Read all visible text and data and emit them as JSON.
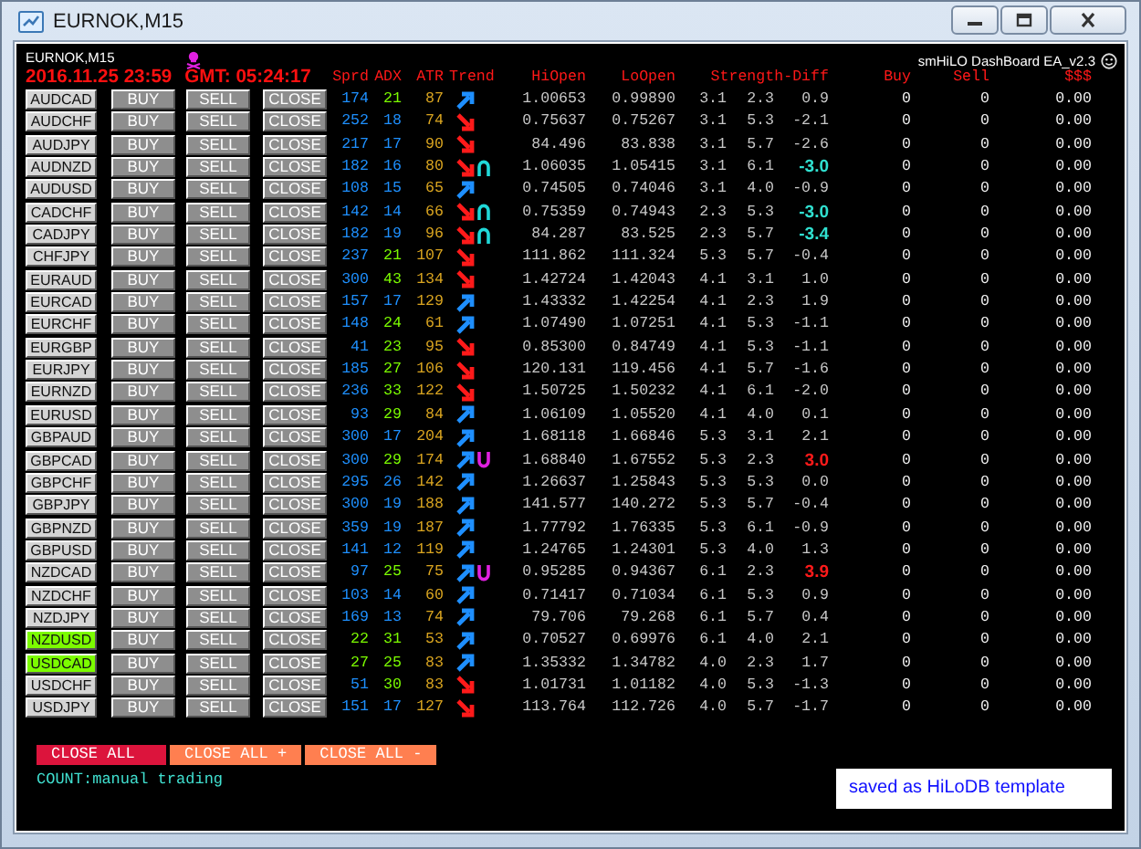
{
  "window": {
    "title": "EURNOK,M15"
  },
  "symbol_label": "EURNOK,M15",
  "ea_name": "smHiLO DashBoard EA_v2.3",
  "date": "2016.11.25 23:59",
  "gmt": "GMT: 05:24:17",
  "columns": [
    "Sprd",
    "ADX",
    "ATR",
    "Trend",
    "HiOpen",
    "LoOpen",
    "Strength-Diff",
    "Buy",
    "Sell",
    "$$$"
  ],
  "rows": [
    {
      "pair": "AUDCAD",
      "selected": false,
      "buy": "BUY",
      "sell": "SELL",
      "close": "CLOSE",
      "spread": "174",
      "spread_low": false,
      "adx": "21",
      "adx_strong": true,
      "atr": "87",
      "rising": true,
      "sell_signal": false,
      "buy_signal": false,
      "hi": "1.00653",
      "lo": "0.99890",
      "s1": "3.1",
      "s2": "2.3",
      "diff": "0.9",
      "diff_sell_alert": false,
      "diff_buy_alert": false,
      "buys": "0",
      "sells": "0",
      "profit": "0.00"
    },
    {
      "pair": "AUDCHF",
      "selected": false,
      "buy": "BUY",
      "sell": "SELL",
      "close": "CLOSE",
      "spread": "252",
      "spread_low": false,
      "adx": "18",
      "adx_strong": false,
      "atr": "74",
      "rising": false,
      "sell_signal": false,
      "buy_signal": false,
      "hi": "0.75637",
      "lo": "0.75267",
      "s1": "3.1",
      "s2": "5.3",
      "diff": "-2.1",
      "diff_sell_alert": false,
      "diff_buy_alert": false,
      "buys": "0",
      "sells": "0",
      "profit": "0.00"
    },
    {
      "pair": "AUDJPY",
      "selected": false,
      "buy": "BUY",
      "sell": "SELL",
      "close": "CLOSE",
      "spread": "217",
      "spread_low": false,
      "adx": "17",
      "adx_strong": false,
      "atr": "90",
      "rising": false,
      "sell_signal": false,
      "buy_signal": false,
      "hi": "84.496",
      "lo": "83.838",
      "s1": "3.1",
      "s2": "5.7",
      "diff": "-2.6",
      "diff_sell_alert": false,
      "diff_buy_alert": false,
      "buys": "0",
      "sells": "0",
      "profit": "0.00"
    },
    {
      "pair": "AUDNZD",
      "selected": false,
      "buy": "BUY",
      "sell": "SELL",
      "close": "CLOSE",
      "spread": "182",
      "spread_low": false,
      "adx": "16",
      "adx_strong": false,
      "atr": "80",
      "rising": false,
      "sell_signal": true,
      "buy_signal": false,
      "hi": "1.06035",
      "lo": "1.05415",
      "s1": "3.1",
      "s2": "6.1",
      "diff": "-3.0",
      "diff_sell_alert": true,
      "diff_buy_alert": false,
      "buys": "0",
      "sells": "0",
      "profit": "0.00"
    },
    {
      "pair": "AUDUSD",
      "selected": false,
      "buy": "BUY",
      "sell": "SELL",
      "close": "CLOSE",
      "spread": "108",
      "spread_low": false,
      "adx": "15",
      "adx_strong": false,
      "atr": "65",
      "rising": true,
      "sell_signal": false,
      "buy_signal": false,
      "hi": "0.74505",
      "lo": "0.74046",
      "s1": "3.1",
      "s2": "4.0",
      "diff": "-0.9",
      "diff_sell_alert": false,
      "diff_buy_alert": false,
      "buys": "0",
      "sells": "0",
      "profit": "0.00"
    },
    {
      "pair": "CADCHF",
      "selected": false,
      "buy": "BUY",
      "sell": "SELL",
      "close": "CLOSE",
      "spread": "142",
      "spread_low": false,
      "adx": "14",
      "adx_strong": false,
      "atr": "66",
      "rising": false,
      "sell_signal": true,
      "buy_signal": false,
      "hi": "0.75359",
      "lo": "0.74943",
      "s1": "2.3",
      "s2": "5.3",
      "diff": "-3.0",
      "diff_sell_alert": true,
      "diff_buy_alert": false,
      "buys": "0",
      "sells": "0",
      "profit": "0.00"
    },
    {
      "pair": "CADJPY",
      "selected": false,
      "buy": "BUY",
      "sell": "SELL",
      "close": "CLOSE",
      "spread": "182",
      "spread_low": false,
      "adx": "19",
      "adx_strong": false,
      "atr": "96",
      "rising": false,
      "sell_signal": true,
      "buy_signal": false,
      "hi": "84.287",
      "lo": "83.525",
      "s1": "2.3",
      "s2": "5.7",
      "diff": "-3.4",
      "diff_sell_alert": true,
      "diff_buy_alert": false,
      "buys": "0",
      "sells": "0",
      "profit": "0.00"
    },
    {
      "pair": "CHFJPY",
      "selected": false,
      "buy": "BUY",
      "sell": "SELL",
      "close": "CLOSE",
      "spread": "237",
      "spread_low": false,
      "adx": "21",
      "adx_strong": true,
      "atr": "107",
      "rising": false,
      "sell_signal": false,
      "buy_signal": false,
      "hi": "111.862",
      "lo": "111.324",
      "s1": "5.3",
      "s2": "5.7",
      "diff": "-0.4",
      "diff_sell_alert": false,
      "diff_buy_alert": false,
      "buys": "0",
      "sells": "0",
      "profit": "0.00"
    },
    {
      "pair": "EURAUD",
      "selected": false,
      "buy": "BUY",
      "sell": "SELL",
      "close": "CLOSE",
      "spread": "300",
      "spread_low": false,
      "adx": "43",
      "adx_strong": true,
      "atr": "134",
      "rising": false,
      "sell_signal": false,
      "buy_signal": false,
      "hi": "1.42724",
      "lo": "1.42043",
      "s1": "4.1",
      "s2": "3.1",
      "diff": "1.0",
      "diff_sell_alert": false,
      "diff_buy_alert": false,
      "buys": "0",
      "sells": "0",
      "profit": "0.00"
    },
    {
      "pair": "EURCAD",
      "selected": false,
      "buy": "BUY",
      "sell": "SELL",
      "close": "CLOSE",
      "spread": "157",
      "spread_low": false,
      "adx": "17",
      "adx_strong": false,
      "atr": "129",
      "rising": true,
      "sell_signal": false,
      "buy_signal": false,
      "hi": "1.43332",
      "lo": "1.42254",
      "s1": "4.1",
      "s2": "2.3",
      "diff": "1.9",
      "diff_sell_alert": false,
      "diff_buy_alert": false,
      "buys": "0",
      "sells": "0",
      "profit": "0.00"
    },
    {
      "pair": "EURCHF",
      "selected": false,
      "buy": "BUY",
      "sell": "SELL",
      "close": "CLOSE",
      "spread": "148",
      "spread_low": false,
      "adx": "24",
      "adx_strong": true,
      "atr": "61",
      "rising": true,
      "sell_signal": false,
      "buy_signal": false,
      "hi": "1.07490",
      "lo": "1.07251",
      "s1": "4.1",
      "s2": "5.3",
      "diff": "-1.1",
      "diff_sell_alert": false,
      "diff_buy_alert": false,
      "buys": "0",
      "sells": "0",
      "profit": "0.00"
    },
    {
      "pair": "EURGBP",
      "selected": false,
      "buy": "BUY",
      "sell": "SELL",
      "close": "CLOSE",
      "spread": "41",
      "spread_low": false,
      "adx": "23",
      "adx_strong": true,
      "atr": "95",
      "rising": false,
      "sell_signal": false,
      "buy_signal": false,
      "hi": "0.85300",
      "lo": "0.84749",
      "s1": "4.1",
      "s2": "5.3",
      "diff": "-1.1",
      "diff_sell_alert": false,
      "diff_buy_alert": false,
      "buys": "0",
      "sells": "0",
      "profit": "0.00"
    },
    {
      "pair": "EURJPY",
      "selected": false,
      "buy": "BUY",
      "sell": "SELL",
      "close": "CLOSE",
      "spread": "185",
      "spread_low": false,
      "adx": "27",
      "adx_strong": true,
      "atr": "106",
      "rising": false,
      "sell_signal": false,
      "buy_signal": false,
      "hi": "120.131",
      "lo": "119.456",
      "s1": "4.1",
      "s2": "5.7",
      "diff": "-1.6",
      "diff_sell_alert": false,
      "diff_buy_alert": false,
      "buys": "0",
      "sells": "0",
      "profit": "0.00"
    },
    {
      "pair": "EURNZD",
      "selected": false,
      "buy": "BUY",
      "sell": "SELL",
      "close": "CLOSE",
      "spread": "236",
      "spread_low": false,
      "adx": "33",
      "adx_strong": true,
      "atr": "122",
      "rising": false,
      "sell_signal": false,
      "buy_signal": false,
      "hi": "1.50725",
      "lo": "1.50232",
      "s1": "4.1",
      "s2": "6.1",
      "diff": "-2.0",
      "diff_sell_alert": false,
      "diff_buy_alert": false,
      "buys": "0",
      "sells": "0",
      "profit": "0.00"
    },
    {
      "pair": "EURUSD",
      "selected": false,
      "buy": "BUY",
      "sell": "SELL",
      "close": "CLOSE",
      "spread": "93",
      "spread_low": false,
      "adx": "29",
      "adx_strong": true,
      "atr": "84",
      "rising": true,
      "sell_signal": false,
      "buy_signal": false,
      "hi": "1.06109",
      "lo": "1.05520",
      "s1": "4.1",
      "s2": "4.0",
      "diff": "0.1",
      "diff_sell_alert": false,
      "diff_buy_alert": false,
      "buys": "0",
      "sells": "0",
      "profit": "0.00"
    },
    {
      "pair": "GBPAUD",
      "selected": false,
      "buy": "BUY",
      "sell": "SELL",
      "close": "CLOSE",
      "spread": "300",
      "spread_low": false,
      "adx": "17",
      "adx_strong": false,
      "atr": "204",
      "rising": true,
      "sell_signal": false,
      "buy_signal": false,
      "hi": "1.68118",
      "lo": "1.66846",
      "s1": "5.3",
      "s2": "3.1",
      "diff": "2.1",
      "diff_sell_alert": false,
      "diff_buy_alert": false,
      "buys": "0",
      "sells": "0",
      "profit": "0.00"
    },
    {
      "pair": "GBPCAD",
      "selected": false,
      "buy": "BUY",
      "sell": "SELL",
      "close": "CLOSE",
      "spread": "300",
      "spread_low": false,
      "adx": "29",
      "adx_strong": true,
      "atr": "174",
      "rising": true,
      "sell_signal": false,
      "buy_signal": true,
      "hi": "1.68840",
      "lo": "1.67552",
      "s1": "5.3",
      "s2": "2.3",
      "diff": "3.0",
      "diff_sell_alert": false,
      "diff_buy_alert": true,
      "buys": "0",
      "sells": "0",
      "profit": "0.00"
    },
    {
      "pair": "GBPCHF",
      "selected": false,
      "buy": "BUY",
      "sell": "SELL",
      "close": "CLOSE",
      "spread": "295",
      "spread_low": false,
      "adx": "26",
      "adx_strong": false,
      "atr": "142",
      "rising": true,
      "sell_signal": false,
      "buy_signal": false,
      "hi": "1.26637",
      "lo": "1.25843",
      "s1": "5.3",
      "s2": "5.3",
      "diff": "0.0",
      "diff_sell_alert": false,
      "diff_buy_alert": false,
      "buys": "0",
      "sells": "0",
      "profit": "0.00"
    },
    {
      "pair": "GBPJPY",
      "selected": false,
      "buy": "BUY",
      "sell": "SELL",
      "close": "CLOSE",
      "spread": "300",
      "spread_low": false,
      "adx": "19",
      "adx_strong": false,
      "atr": "188",
      "rising": true,
      "sell_signal": false,
      "buy_signal": false,
      "hi": "141.577",
      "lo": "140.272",
      "s1": "5.3",
      "s2": "5.7",
      "diff": "-0.4",
      "diff_sell_alert": false,
      "diff_buy_alert": false,
      "buys": "0",
      "sells": "0",
      "profit": "0.00"
    },
    {
      "pair": "GBPNZD",
      "selected": false,
      "buy": "BUY",
      "sell": "SELL",
      "close": "CLOSE",
      "spread": "359",
      "spread_low": false,
      "adx": "19",
      "adx_strong": false,
      "atr": "187",
      "rising": true,
      "sell_signal": false,
      "buy_signal": false,
      "hi": "1.77792",
      "lo": "1.76335",
      "s1": "5.3",
      "s2": "6.1",
      "diff": "-0.9",
      "diff_sell_alert": false,
      "diff_buy_alert": false,
      "buys": "0",
      "sells": "0",
      "profit": "0.00"
    },
    {
      "pair": "GBPUSD",
      "selected": false,
      "buy": "BUY",
      "sell": "SELL",
      "close": "CLOSE",
      "spread": "141",
      "spread_low": false,
      "adx": "12",
      "adx_strong": false,
      "atr": "119",
      "rising": true,
      "sell_signal": false,
      "buy_signal": false,
      "hi": "1.24765",
      "lo": "1.24301",
      "s1": "5.3",
      "s2": "4.0",
      "diff": "1.3",
      "diff_sell_alert": false,
      "diff_buy_alert": false,
      "buys": "0",
      "sells": "0",
      "profit": "0.00"
    },
    {
      "pair": "NZDCAD",
      "selected": false,
      "buy": "BUY",
      "sell": "SELL",
      "close": "CLOSE",
      "spread": "97",
      "spread_low": false,
      "adx": "25",
      "adx_strong": true,
      "atr": "75",
      "rising": true,
      "sell_signal": false,
      "buy_signal": true,
      "hi": "0.95285",
      "lo": "0.94367",
      "s1": "6.1",
      "s2": "2.3",
      "diff": "3.9",
      "diff_sell_alert": false,
      "diff_buy_alert": true,
      "buys": "0",
      "sells": "0",
      "profit": "0.00"
    },
    {
      "pair": "NZDCHF",
      "selected": false,
      "buy": "BUY",
      "sell": "SELL",
      "close": "CLOSE",
      "spread": "103",
      "spread_low": false,
      "adx": "14",
      "adx_strong": false,
      "atr": "60",
      "rising": true,
      "sell_signal": false,
      "buy_signal": false,
      "hi": "0.71417",
      "lo": "0.71034",
      "s1": "6.1",
      "s2": "5.3",
      "diff": "0.9",
      "diff_sell_alert": false,
      "diff_buy_alert": false,
      "buys": "0",
      "sells": "0",
      "profit": "0.00"
    },
    {
      "pair": "NZDJPY",
      "selected": false,
      "buy": "BUY",
      "sell": "SELL",
      "close": "CLOSE",
      "spread": "169",
      "spread_low": false,
      "adx": "13",
      "adx_strong": false,
      "atr": "74",
      "rising": true,
      "sell_signal": false,
      "buy_signal": false,
      "hi": "79.706",
      "lo": "79.268",
      "s1": "6.1",
      "s2": "5.7",
      "diff": "0.4",
      "diff_sell_alert": false,
      "diff_buy_alert": false,
      "buys": "0",
      "sells": "0",
      "profit": "0.00"
    },
    {
      "pair": "NZDUSD",
      "selected": true,
      "buy": "BUY",
      "sell": "SELL",
      "close": "CLOSE",
      "spread": "22",
      "spread_low": true,
      "adx": "31",
      "adx_strong": true,
      "atr": "53",
      "rising": true,
      "sell_signal": false,
      "buy_signal": false,
      "hi": "0.70527",
      "lo": "0.69976",
      "s1": "6.1",
      "s2": "4.0",
      "diff": "2.1",
      "diff_sell_alert": false,
      "diff_buy_alert": false,
      "buys": "0",
      "sells": "0",
      "profit": "0.00"
    },
    {
      "pair": "USDCAD",
      "selected": true,
      "buy": "BUY",
      "sell": "SELL",
      "close": "CLOSE",
      "spread": "27",
      "spread_low": true,
      "adx": "25",
      "adx_strong": true,
      "atr": "83",
      "rising": true,
      "sell_signal": false,
      "buy_signal": false,
      "hi": "1.35332",
      "lo": "1.34782",
      "s1": "4.0",
      "s2": "2.3",
      "diff": "1.7",
      "diff_sell_alert": false,
      "diff_buy_alert": false,
      "buys": "0",
      "sells": "0",
      "profit": "0.00"
    },
    {
      "pair": "USDCHF",
      "selected": false,
      "buy": "BUY",
      "sell": "SELL",
      "close": "CLOSE",
      "spread": "51",
      "spread_low": false,
      "adx": "30",
      "adx_strong": true,
      "atr": "83",
      "rising": false,
      "sell_signal": false,
      "buy_signal": false,
      "hi": "1.01731",
      "lo": "1.01182",
      "s1": "4.0",
      "s2": "5.3",
      "diff": "-1.3",
      "diff_sell_alert": false,
      "diff_buy_alert": false,
      "buys": "0",
      "sells": "0",
      "profit": "0.00"
    },
    {
      "pair": "USDJPY",
      "selected": false,
      "buy": "BUY",
      "sell": "SELL",
      "close": "CLOSE",
      "spread": "151",
      "spread_low": false,
      "adx": "17",
      "adx_strong": false,
      "atr": "127",
      "rising": false,
      "sell_signal": false,
      "buy_signal": false,
      "hi": "113.764",
      "lo": "112.726",
      "s1": "4.0",
      "s2": "5.7",
      "diff": "-1.7",
      "diff_sell_alert": false,
      "diff_buy_alert": false,
      "buys": "0",
      "sells": "0",
      "profit": "0.00"
    }
  ],
  "close_buttons": [
    {
      "label": "CLOSE ALL",
      "kind": "all"
    },
    {
      "label": "CLOSE ALL +",
      "kind": "profit"
    },
    {
      "label": "CLOSE ALL -",
      "kind": "loss"
    }
  ],
  "count": "COUNT:manual trading",
  "notice": "saved as HiLoDB template"
}
